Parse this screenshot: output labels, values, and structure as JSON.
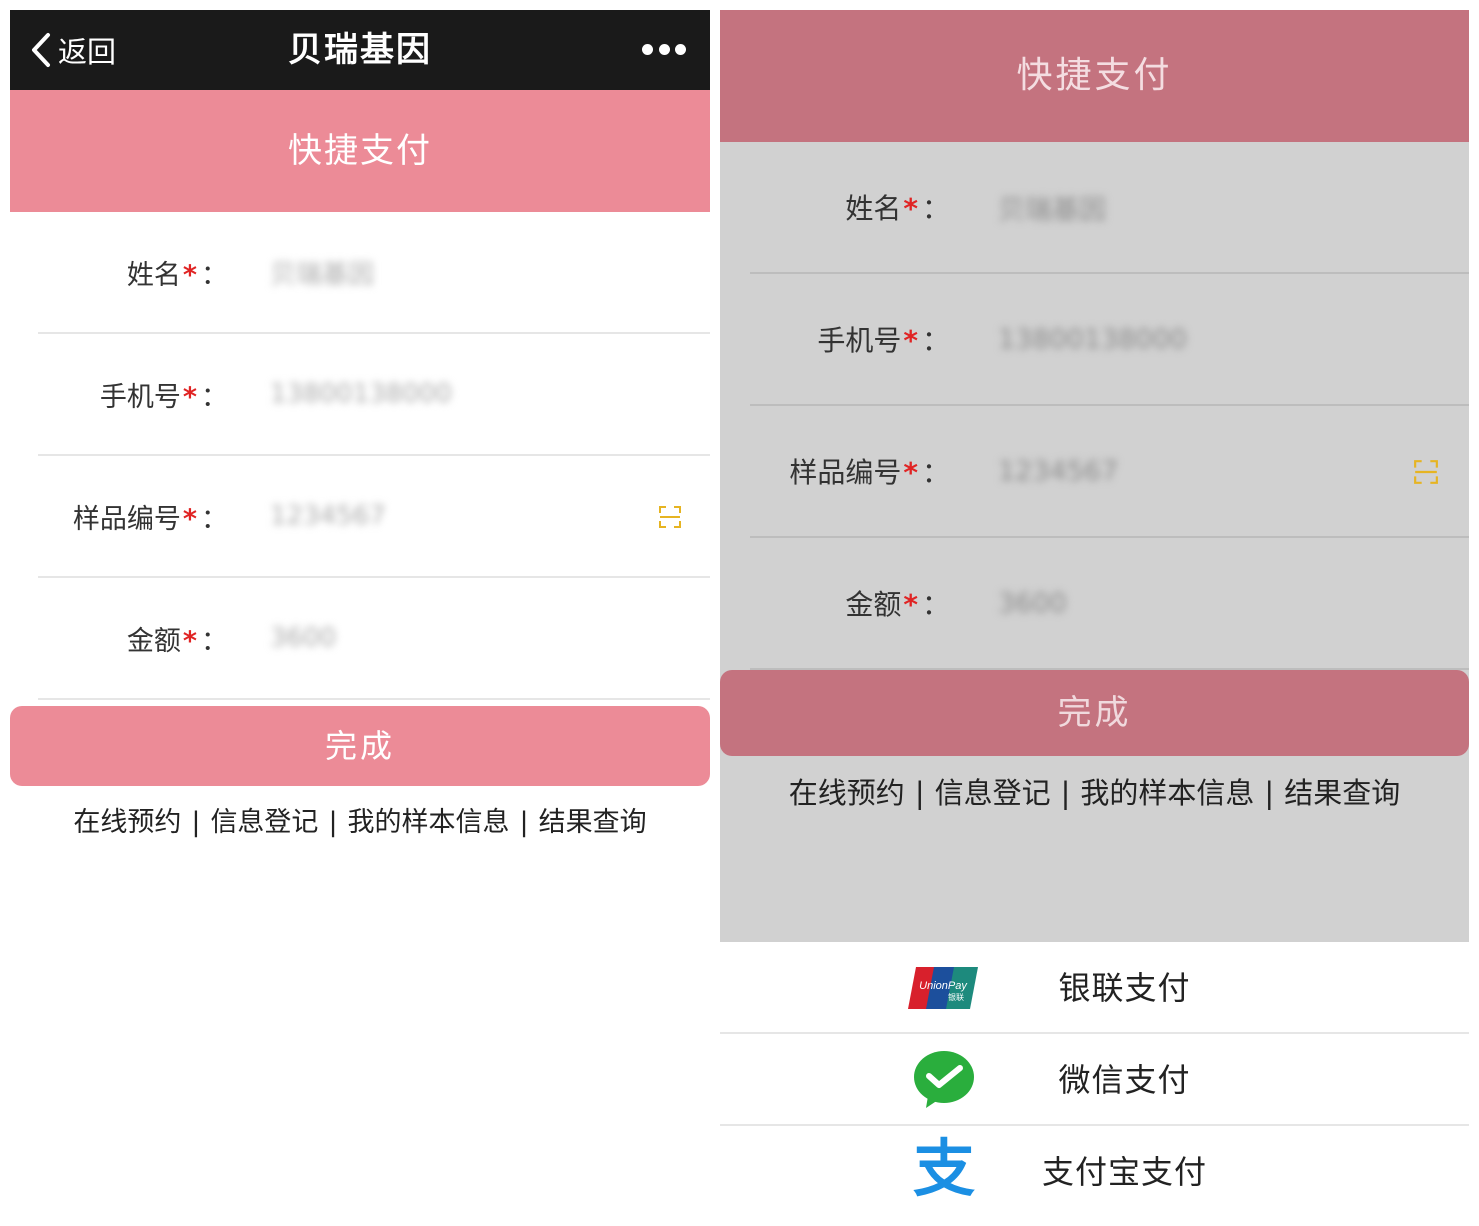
{
  "left_screen": {
    "nav": {
      "back_label": "返回",
      "title": "贝瑞基因",
      "more_icon": "more-dots-icon"
    },
    "header_title": "快捷支付",
    "fields": [
      {
        "label": "姓名",
        "required": "*",
        "colon": "：",
        "value": "贝瑞基因"
      },
      {
        "label": "手机号",
        "required": "*",
        "colon": "：",
        "value": "13800138000"
      },
      {
        "label": "样品编号",
        "required": "*",
        "colon": "：",
        "value": "1234567"
      },
      {
        "label": "金额",
        "required": "*",
        "colon": "：",
        "value": "3600"
      }
    ],
    "submit_label": "完成",
    "links": [
      "在线预约",
      "信息登记",
      "我的样本信息",
      "结果查询"
    ],
    "link_separator": "|"
  },
  "right_screen": {
    "header_title": "快捷支付",
    "fields": [
      {
        "label": "姓名",
        "required": "*",
        "colon": "：",
        "value": "贝瑞基因"
      },
      {
        "label": "手机号",
        "required": "*",
        "colon": "：",
        "value": "13800138000"
      },
      {
        "label": "样品编号",
        "required": "*",
        "colon": "：",
        "value": "1234567"
      },
      {
        "label": "金额",
        "required": "*",
        "colon": "：",
        "value": "3600"
      }
    ],
    "submit_label": "完成",
    "links": [
      "在线预约",
      "信息登记",
      "我的样本信息",
      "结果查询"
    ],
    "link_separator": "|",
    "payment_options": [
      {
        "label": "银联支付",
        "icon": "unionpay-icon",
        "logo_text": "UnionPay",
        "logo_subtext": "银联"
      },
      {
        "label": "微信支付",
        "icon": "wechat-pay-icon"
      },
      {
        "label": "支付宝支付",
        "icon": "alipay-icon",
        "logo_text": "支"
      }
    ]
  },
  "colors": {
    "nav_bg": "#1a1a1a",
    "accent_pink": "#ec8b97",
    "accent_pink_dimmed": "#c4737f",
    "required_red": "#e02424",
    "scan_icon_yellow": "#e6b422",
    "overlay_gray": "#d1d1d1",
    "wechat_green": "#2aae3d",
    "alipay_blue": "#1b8fe3"
  }
}
